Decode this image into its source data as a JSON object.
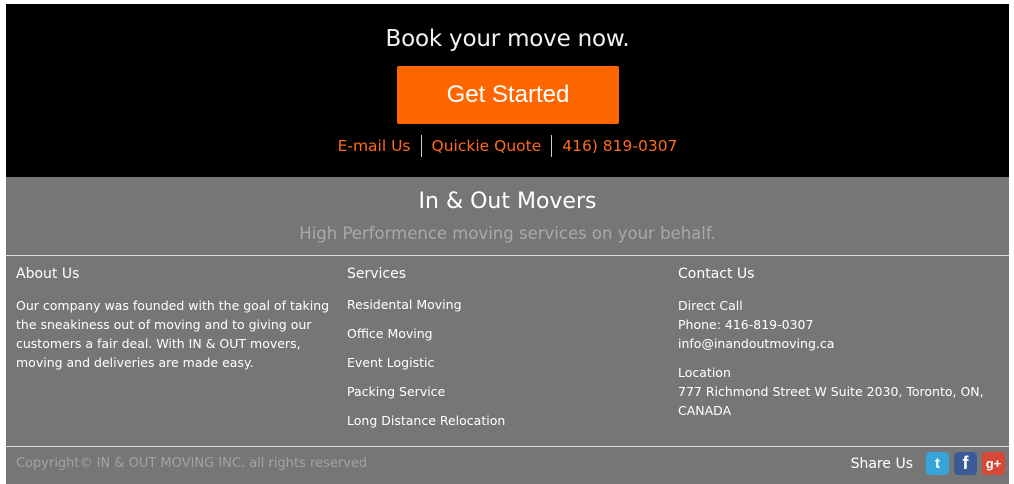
{
  "cta": {
    "title": "Book your move now.",
    "button_label": "Get Started",
    "links": [
      "E-mail Us",
      "Quickie Quote",
      "416) 819-0307"
    ]
  },
  "brand": {
    "name": "In & Out Movers",
    "tagline": "High Performence moving services on your behalf."
  },
  "about": {
    "heading": "About Us",
    "text": "Our company was founded with the goal of taking the sneakiness out of moving and to giving our customers a fair deal. With IN & OUT movers, moving and deliveries are made easy."
  },
  "services": {
    "heading": "Services",
    "items": [
      "Residental Moving",
      "Office Moving",
      "Event Logistic",
      "Packing Service",
      "Long Distance Relocation"
    ]
  },
  "contact": {
    "heading": "Contact Us",
    "direct_label": "Direct Call",
    "phone": "Phone: 416-819-0307",
    "email": "info@inandoutmoving.ca",
    "location_label": "Location",
    "address": "777 Richmond Street W Suite 2030, Toronto, ON, CANADA"
  },
  "footer": {
    "copyright": "Copyright© IN & OUT MOVING INC. all rights reserved",
    "share_label": "Share Us",
    "social_icons": [
      "twitter-icon",
      "facebook-icon",
      "google-plus-icon"
    ]
  },
  "colors": {
    "accent": "#ff6600",
    "cta_background": "#000000",
    "footer_background": "#767676"
  }
}
